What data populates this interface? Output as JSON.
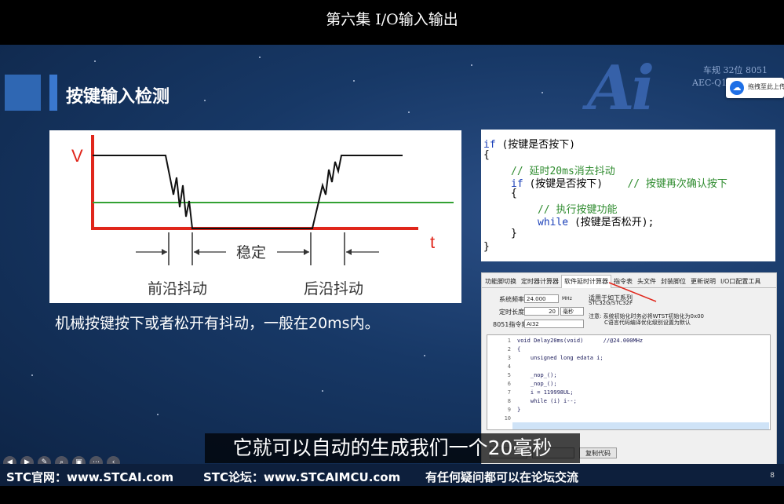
{
  "video_title": "第六集 I/O输入输出",
  "slide": {
    "heading": "按键输入检测",
    "logo": {
      "text": "Ai",
      "line1": "车规 32位 8051",
      "line2": "AEC-Q1"
    },
    "upload_button": "拖拽至此上传",
    "diagram": {
      "v_label": "V",
      "t_label": "t",
      "stable_label": "稳定",
      "front_label": "前沿抖动",
      "back_label": "后沿抖动"
    },
    "caption": "机械按键按下或者松开有抖动，一般在20ms内。",
    "code_lines": [
      {
        "k1": "if",
        "t": " (按键是否按下)"
      },
      {
        "t": "{"
      },
      {
        "c": "// 延时20ms消去抖动"
      },
      {
        "k1": "if",
        "t": " (按键是否按下)",
        "c": "    // 按键再次确认按下"
      },
      {
        "t": "{"
      },
      {
        "c": "// 执行按键功能"
      },
      {
        "k1": "while",
        "t": " (按键是否松开);"
      },
      {
        "t": "}"
      },
      {
        "t": "}"
      }
    ],
    "tool": {
      "tabs": [
        "功能脚切换",
        "定时器计算器",
        "软件延时计算器",
        "指令表",
        "头文件",
        "封装脚位",
        "更新说明",
        "I/O口配置工具"
      ],
      "active_tab": 2,
      "sys_freq_label": "系统频率",
      "sys_freq_value": "24.000",
      "sys_freq_unit": "MHz",
      "delay_label": "定时长度",
      "delay_value": "20",
      "delay_unit": "毫秒",
      "isa_label": "8051指令集",
      "isa_value": "AI32",
      "applies_label": "适用于如下系列",
      "applies_value": "STC32G/STC32F",
      "note_line1": "注意: 系统初始化时务必将WTST初始化为0x00",
      "note_line2": "C语言代码编译优化级别设置为默认",
      "editor_lines": [
        {
          "n": "1",
          "code": "void Delay20ms(void)      //@24.000MHz"
        },
        {
          "n": "2",
          "code": "{"
        },
        {
          "n": "3",
          "code": "    unsigned long edata i;"
        },
        {
          "n": "4",
          "code": ""
        },
        {
          "n": "5",
          "code": "    _nop_();"
        },
        {
          "n": "6",
          "code": "    _nop_();"
        },
        {
          "n": "7",
          "code": "    i = 119998UL;"
        },
        {
          "n": "8",
          "code": "    while (i) i--;"
        },
        {
          "n": "9",
          "code": "}"
        },
        {
          "n": "10",
          "code": ""
        }
      ],
      "copy_button": "复制代码"
    },
    "subtitle": "它就可以自动的生成我们一个20毫秒",
    "footer": {
      "site": "STC官网：www.STCAI.com",
      "forum": "STC论坛：www.STCAIMCU.com",
      "note": "有任何疑问都可以在论坛交流",
      "page": "8"
    }
  },
  "colors": {
    "accent_red": "#e0261b",
    "accent_green": "#33a133",
    "keyword_blue": "#1a3fb8"
  }
}
